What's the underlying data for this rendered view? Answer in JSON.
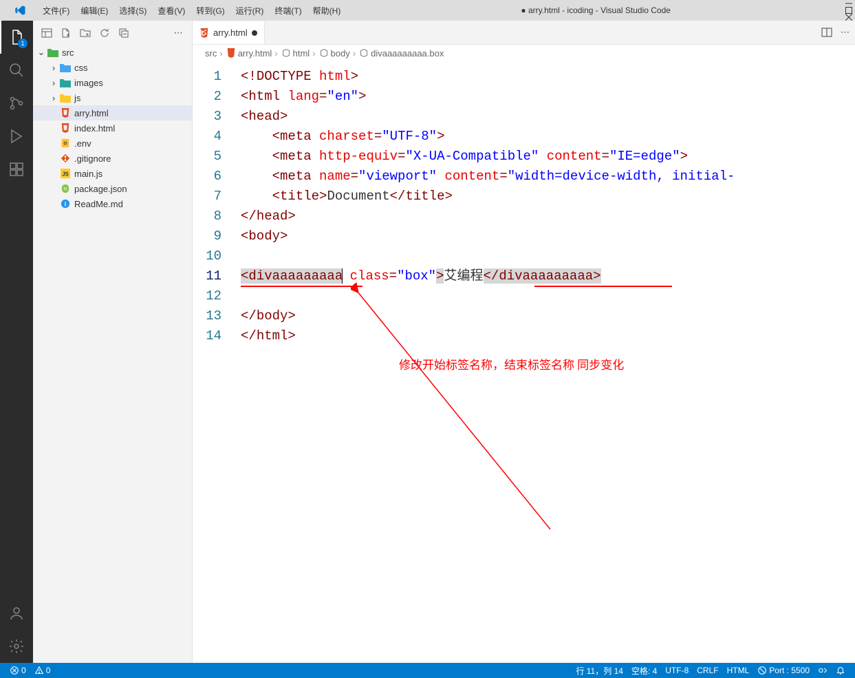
{
  "window": {
    "title": "● arry.html - icoding - Visual Studio Code"
  },
  "menu": {
    "file": "文件(F)",
    "edit": "编辑(E)",
    "select": "选择(S)",
    "view": "查看(V)",
    "goto": "转到(G)",
    "run": "运行(R)",
    "terminal": "终端(T)",
    "help": "帮助(H)"
  },
  "activity_badge": "1",
  "explorer": {
    "root": {
      "name": "src"
    },
    "folders": [
      {
        "name": "css",
        "icon": "css"
      },
      {
        "name": "images",
        "icon": "img"
      },
      {
        "name": "js",
        "icon": "js-folder"
      }
    ],
    "files": [
      {
        "name": "arry.html",
        "icon": "html5",
        "active": true
      },
      {
        "name": "index.html",
        "icon": "html5"
      },
      {
        "name": ".env",
        "icon": "env"
      },
      {
        "name": ".gitignore",
        "icon": "git"
      },
      {
        "name": "main.js",
        "icon": "js"
      },
      {
        "name": "package.json",
        "icon": "json"
      },
      {
        "name": "ReadMe.md",
        "icon": "info"
      }
    ]
  },
  "tab": {
    "name": "arry.html"
  },
  "breadcrumbs": {
    "p1": "src",
    "p2": "arry.html",
    "p3": "html",
    "p4": "body",
    "p5": "divaaaaaaaaa.box"
  },
  "code": {
    "lines": [
      {
        "n": "1",
        "html": "<span class='c-angle'>&lt;!</span><span class='c-doctype'>DOCTYPE</span> <span class='c-attr'>html</span><span class='c-angle'>&gt;</span>"
      },
      {
        "n": "2",
        "html": "<span class='c-angle'>&lt;</span><span class='c-tag'>html</span> <span class='c-attr'>lang</span><span class='c-angle'>=</span><span class='c-str'>\"en\"</span><span class='c-angle'>&gt;</span>"
      },
      {
        "n": "3",
        "html": "<span class='c-angle'>&lt;</span><span class='c-tag'>head</span><span class='c-angle'>&gt;</span>"
      },
      {
        "n": "4",
        "html": "    <span class='c-angle'>&lt;</span><span class='c-tag'>meta</span> <span class='c-attr'>charset</span><span class='c-angle'>=</span><span class='c-str'>\"UTF-8\"</span><span class='c-angle'>&gt;</span>"
      },
      {
        "n": "5",
        "html": "    <span class='c-angle'>&lt;</span><span class='c-tag'>meta</span> <span class='c-attr'>http-equiv</span><span class='c-angle'>=</span><span class='c-str'>\"X-UA-Compatible\"</span> <span class='c-attr'>content</span><span class='c-angle'>=</span><span class='c-str'>\"IE=edge\"</span><span class='c-angle'>&gt;</span>"
      },
      {
        "n": "6",
        "html": "    <span class='c-angle'>&lt;</span><span class='c-tag'>meta</span> <span class='c-attr'>name</span><span class='c-angle'>=</span><span class='c-str'>\"viewport\"</span> <span class='c-attr'>content</span><span class='c-angle'>=</span><span class='c-str'>\"width=device-width, initial-</span>"
      },
      {
        "n": "7",
        "html": "    <span class='c-angle'>&lt;</span><span class='c-tag'>title</span><span class='c-angle'>&gt;</span><span class='c-text'>Document</span><span class='c-angle'>&lt;/</span><span class='c-tag'>title</span><span class='c-angle'>&gt;</span>"
      },
      {
        "n": "8",
        "html": "<span class='c-angle'>&lt;/</span><span class='c-tag'>head</span><span class='c-angle'>&gt;</span>"
      },
      {
        "n": "9",
        "html": "<span class='c-angle'>&lt;</span><span class='c-tag'>body</span><span class='c-angle'>&gt;</span>"
      },
      {
        "n": "10",
        "html": ""
      },
      {
        "n": "11",
        "html": "<span class='sel-tag'><span class='c-angle'>&lt;</span><span class='c-tag'>divaaaaaaaaa</span></span><span class='cursor'></span> <span class='c-attr'>class</span><span class='c-angle'>=</span><span class='c-str'>\"box\"</span><span class='sel-tag'><span class='c-angle'>&gt;</span></span><span class='c-text'>艾编程</span><span class='sel-tag'><span class='c-angle'>&lt;/</span><span class='c-tag'>divaaaaaaaaa</span><span class='c-angle'>&gt;</span></span>"
      },
      {
        "n": "12",
        "html": ""
      },
      {
        "n": "13",
        "html": "<span class='c-angle'>&lt;/</span><span class='c-tag'>body</span><span class='c-angle'>&gt;</span>"
      },
      {
        "n": "14",
        "html": "<span class='c-angle'>&lt;/</span><span class='c-tag'>html</span><span class='c-angle'>&gt;</span>"
      }
    ],
    "current_line": 11
  },
  "annotation": "修改开始标签名称，结束标签名称 同步变化",
  "statusbar": {
    "errors": "0",
    "warnings": "0",
    "line_col": "行 11，列 14",
    "spaces": "空格: 4",
    "encoding": "UTF-8",
    "eol": "CRLF",
    "lang": "HTML",
    "port": "Port : 5500"
  }
}
